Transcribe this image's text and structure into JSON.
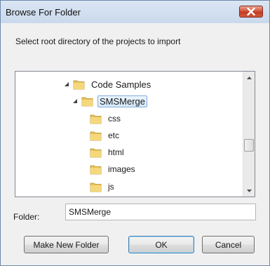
{
  "window": {
    "title": "Browse For Folder",
    "close_icon": "close-icon"
  },
  "instruction": "Select root directory of the projects to import",
  "tree": {
    "items": [
      {
        "label": "Code Samples",
        "expander": "expanded",
        "icon": "folder-icon"
      },
      {
        "label": "SMSMerge",
        "expander": "expanded",
        "icon": "folder-icon",
        "selected": true
      },
      {
        "label": "css",
        "icon": "folder-icon"
      },
      {
        "label": "etc",
        "icon": "folder-icon"
      },
      {
        "label": "html",
        "icon": "folder-icon"
      },
      {
        "label": "images",
        "icon": "folder-icon"
      },
      {
        "label": "js",
        "icon": "folder-icon"
      }
    ]
  },
  "folder_field": {
    "label": "Folder:",
    "value": "SMSMerge"
  },
  "buttons": {
    "make_new_folder": "Make New Folder",
    "ok": "OK",
    "cancel": "Cancel"
  },
  "colors": {
    "selection_border": "#84acdd",
    "close_button": "#c23b22",
    "folder_yellow": "#e8c25a"
  }
}
